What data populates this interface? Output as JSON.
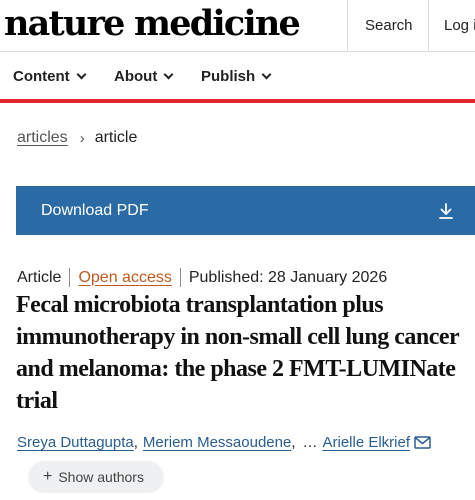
{
  "header": {
    "logo": "nature medicine",
    "search_label": "Search",
    "login_label": "Log in"
  },
  "nav": {
    "items": [
      {
        "label": "Content",
        "icon": "chevron-down-icon"
      },
      {
        "label": "About",
        "icon": "chevron-down-icon"
      },
      {
        "label": "Publish",
        "icon": "chevron-down-icon"
      }
    ],
    "accent_color": "#e0252c"
  },
  "breadcrumb": {
    "parent": "articles",
    "separator": "›",
    "current": "article"
  },
  "download": {
    "label": "Download PDF",
    "icon": "download-icon",
    "color": "#2a6aa5"
  },
  "meta": {
    "type": "Article",
    "access": "Open access",
    "published": "Published: 28 January 2026",
    "access_color": "#c05a1f"
  },
  "article": {
    "title": "Fecal microbiota transplantation plus immunotherapy in non-small cell lung cancer and melanoma: the phase 2 FMT-LUMINate trial"
  },
  "authors": {
    "names": [
      "Sreya Duttagupta",
      "Meriem Messaoudene",
      "Arielle Elkrief"
    ],
    "separator": ",",
    "ellipsis": "…",
    "contact_icon": "mail-icon",
    "link_color": "#2a5d8f"
  },
  "show_authors": {
    "plus": "+",
    "label": "Show authors"
  }
}
